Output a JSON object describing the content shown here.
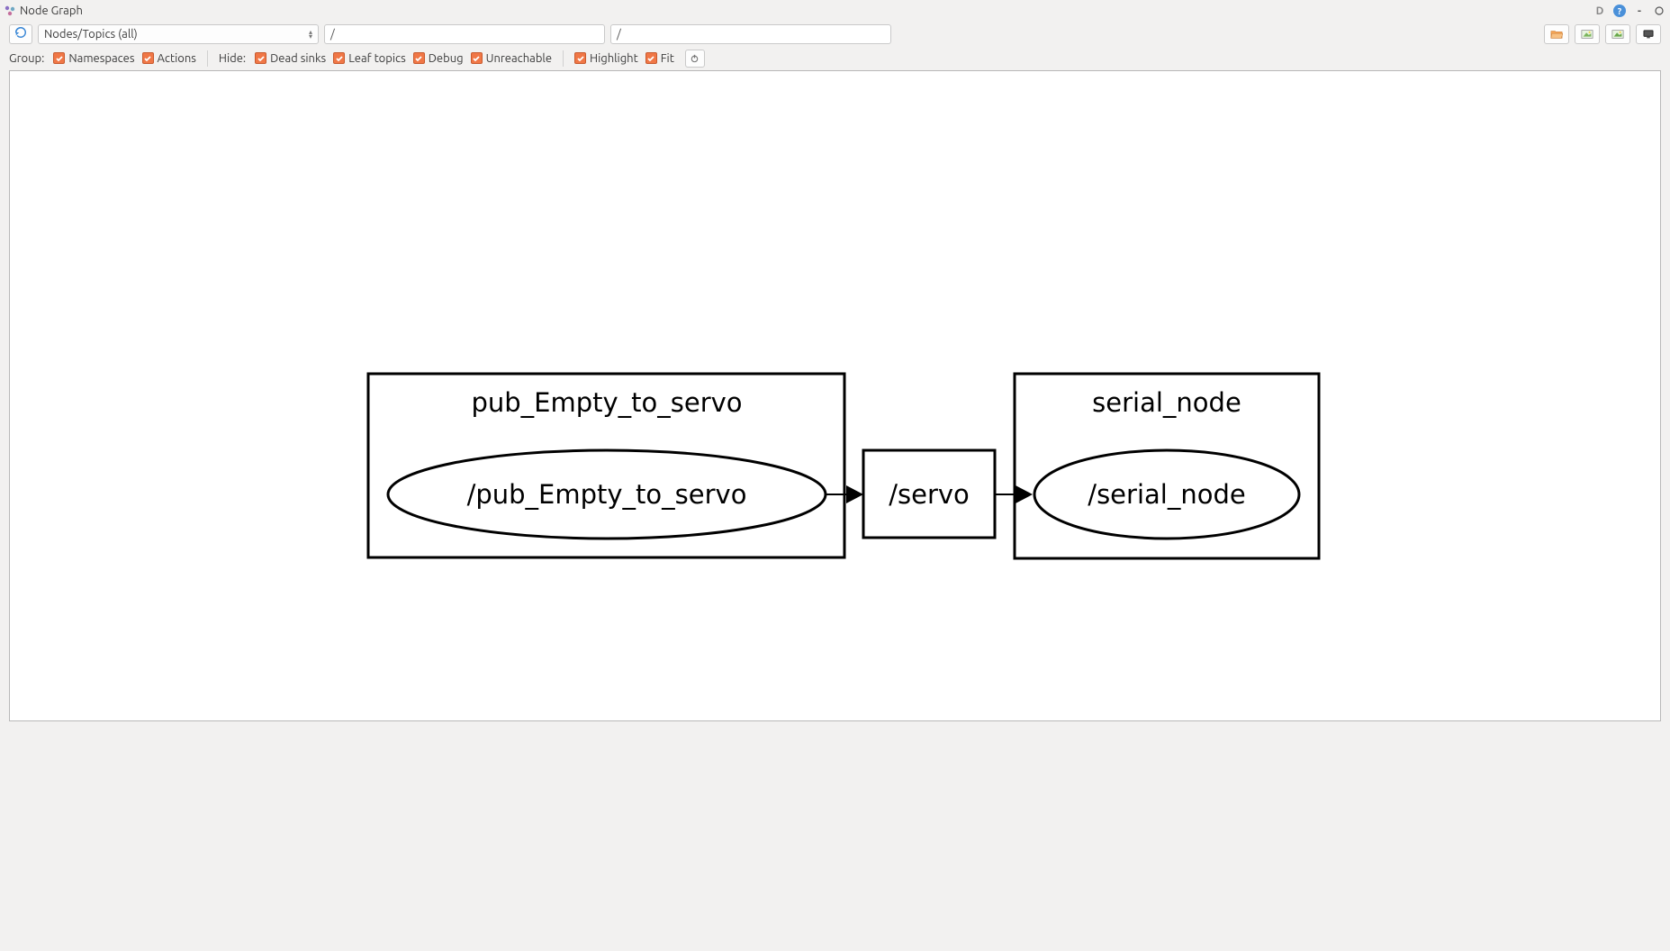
{
  "window": {
    "title": "Node Graph"
  },
  "toolbar": {
    "dropdown_value": "Nodes/Topics (all)",
    "filter1": "/",
    "filter2": "/"
  },
  "options": {
    "group_label": "Group:",
    "namespaces": "Namespaces",
    "actions": "Actions",
    "hide_label": "Hide:",
    "dead_sinks": "Dead sinks",
    "leaf_topics": "Leaf topics",
    "debug": "Debug",
    "unreachable": "Unreachable",
    "highlight": "Highlight",
    "fit": "Fit"
  },
  "graph": {
    "group1_title": "pub_Empty_to_servo",
    "node1": "/pub_Empty_to_servo",
    "topic": "/servo",
    "group2_title": "serial_node",
    "node2": "/serial_node"
  }
}
